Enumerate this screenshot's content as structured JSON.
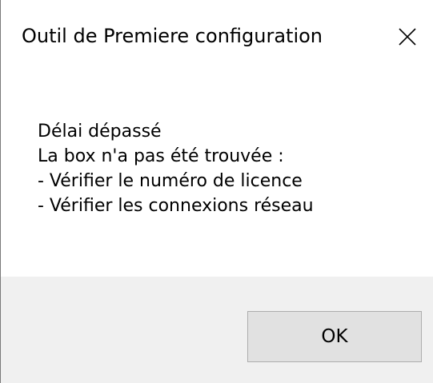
{
  "window": {
    "title": "Outil de Premiere configuration",
    "close_icon": "close-x-icon"
  },
  "message": {
    "lines": [
      "Délai dépassé",
      "La box n'a pas été trouvée :",
      "- Vérifier le numéro de licence",
      "- Vérifier les connexions réseau"
    ]
  },
  "buttons": {
    "ok_label": "OK"
  },
  "colors": {
    "dialog_background": "#ffffff",
    "footer_background": "#f0f0f0",
    "button_face": "#e1e1e1",
    "button_border": "#adadad"
  }
}
